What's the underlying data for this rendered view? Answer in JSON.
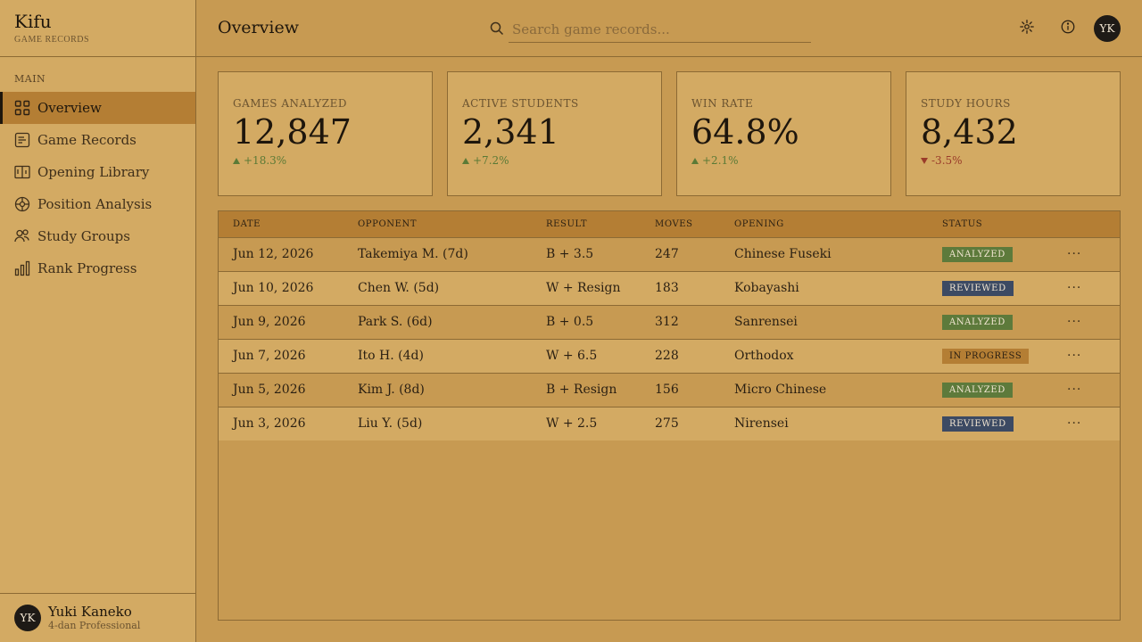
{
  "brand": {
    "title": "Kifu",
    "subtitle": "GAME RECORDS"
  },
  "sidebar": {
    "section_label": "MAIN",
    "items": [
      {
        "label": "Overview",
        "icon": "grid-icon",
        "active": true
      },
      {
        "label": "Game Records",
        "icon": "document-icon"
      },
      {
        "label": "Opening Library",
        "icon": "book-icon"
      },
      {
        "label": "Position Analysis",
        "icon": "target-icon"
      },
      {
        "label": "Study Groups",
        "icon": "users-icon"
      },
      {
        "label": "Rank Progress",
        "icon": "bar-chart-icon"
      }
    ]
  },
  "user": {
    "initials": "YK",
    "name": "Yuki Kaneko",
    "role": "4-dan Professional"
  },
  "header": {
    "title": "Overview",
    "search_placeholder": "Search game records...",
    "avatar_initials": "YK"
  },
  "stats": [
    {
      "label": "GAMES ANALYZED",
      "value": "12,847",
      "delta": "+18.3%",
      "direction": "up"
    },
    {
      "label": "ACTIVE STUDENTS",
      "value": "2,341",
      "delta": "+7.2%",
      "direction": "up"
    },
    {
      "label": "WIN RATE",
      "value": "64.8%",
      "delta": "+2.1%",
      "direction": "up"
    },
    {
      "label": "STUDY HOURS",
      "value": "8,432",
      "delta": "-3.5%",
      "direction": "down"
    }
  ],
  "table": {
    "columns": [
      "DATE",
      "OPPONENT",
      "RESULT",
      "MOVES",
      "OPENING",
      "STATUS"
    ],
    "rows": [
      {
        "date": "Jun 12, 2026",
        "opponent": "Takemiya M. (7d)",
        "result": "B + 3.5",
        "moves": "247",
        "opening": "Chinese Fuseki",
        "status": "ANALYZED"
      },
      {
        "date": "Jun 10, 2026",
        "opponent": "Chen W. (5d)",
        "result": "W + Resign",
        "moves": "183",
        "opening": "Kobayashi",
        "status": "REVIEWED"
      },
      {
        "date": "Jun 9, 2026",
        "opponent": "Park S. (6d)",
        "result": "B + 0.5",
        "moves": "312",
        "opening": "Sanrensei",
        "status": "ANALYZED"
      },
      {
        "date": "Jun 7, 2026",
        "opponent": "Ito H. (4d)",
        "result": "W + 6.5",
        "moves": "228",
        "opening": "Orthodox",
        "status": "IN PROGRESS"
      },
      {
        "date": "Jun 5, 2026",
        "opponent": "Kim J. (8d)",
        "result": "B + Resign",
        "moves": "156",
        "opening": "Micro Chinese",
        "status": "ANALYZED"
      },
      {
        "date": "Jun 3, 2026",
        "opponent": "Liu Y. (5d)",
        "result": "W + 2.5",
        "moves": "275",
        "opening": "Nirensei",
        "status": "REVIEWED"
      }
    ],
    "more_label": "···"
  },
  "colors": {
    "analyzed": "#5d7a3b",
    "reviewed": "#3c4a63",
    "in_progress": "#b47e34",
    "up": "#5b7a36",
    "down": "#9a3b2a"
  }
}
